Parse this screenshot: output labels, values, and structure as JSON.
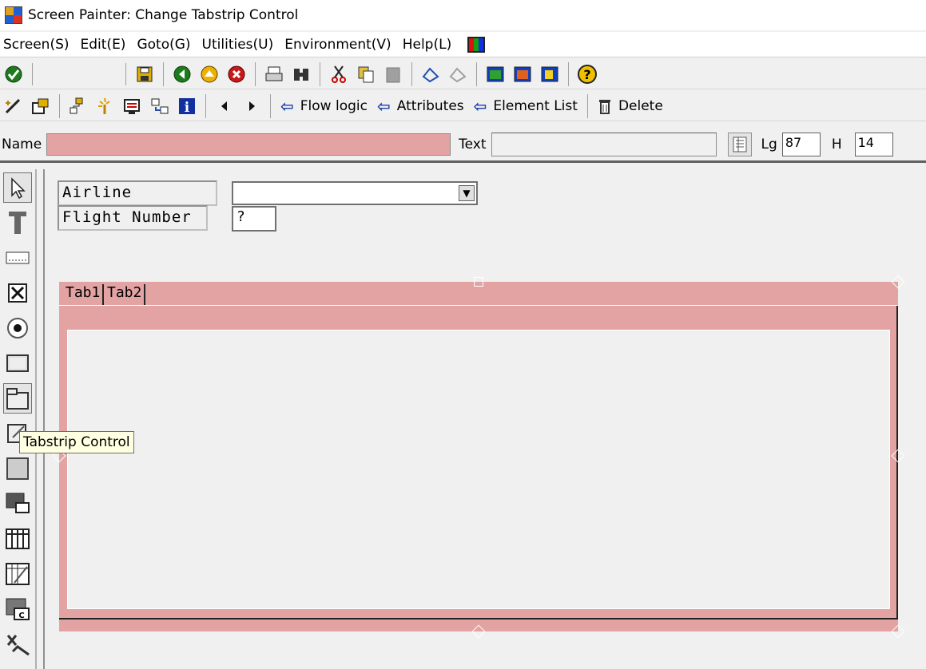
{
  "window": {
    "title": "Screen Painter:  Change Tabstrip Control"
  },
  "menu": {
    "items": [
      "Screen(S)",
      "Edit(E)",
      "Goto(G)",
      "Utilities(U)",
      "Environment(V)",
      "Help(L)"
    ]
  },
  "toolbar2": {
    "flow_logic": "Flow logic",
    "attributes": "Attributes",
    "element_list": "Element List",
    "delete": "Delete"
  },
  "attributes": {
    "name_label": "Name",
    "name_value": "",
    "text_label": "Text",
    "text_value": "",
    "lg_label": "Lg",
    "lg_value": "87",
    "h_label": "H",
    "h_value": "14"
  },
  "canvas": {
    "airline_label": "Airline",
    "airline_value": "",
    "flight_number_label": "Flight Number",
    "flight_number_value": "?",
    "tabs": [
      "Tab1",
      "Tab2"
    ]
  },
  "tooltip": {
    "text": "Tabstrip Control"
  },
  "colors": {
    "selection_fill": "#e3a3a3",
    "tooltip_bg": "#ffffe1",
    "window_bg": "#f0f0f0"
  },
  "icons": {
    "toolbar1": [
      "check-icon",
      "save-icon",
      "back-icon",
      "exit-icon",
      "cancel-icon",
      "print-icon",
      "find-icon",
      "cut-icon",
      "copy-icon",
      "paste-icon",
      "undo-icon",
      "redo-icon",
      "layout-icon-1",
      "layout-icon-2",
      "layout-icon-3",
      "help-icon"
    ],
    "toolbar2": [
      "display-change-icon",
      "other-object-icon",
      "hierarchy-icon",
      "magic-icon",
      "screen-icon",
      "transfer-icon",
      "info-icon",
      "previous-icon",
      "next-icon"
    ],
    "palette": [
      "pointer-icon",
      "text-field-icon",
      "input-field-icon",
      "checkbox-icon",
      "radio-button-icon",
      "pushbutton-icon",
      "box-icon",
      "tabstrip-icon",
      "tabstrip-wizard-icon",
      "subscreen-icon",
      "custom-control-icon",
      "table-control-icon",
      "table-wizard-icon",
      "container-icon",
      "status-icon"
    ]
  }
}
